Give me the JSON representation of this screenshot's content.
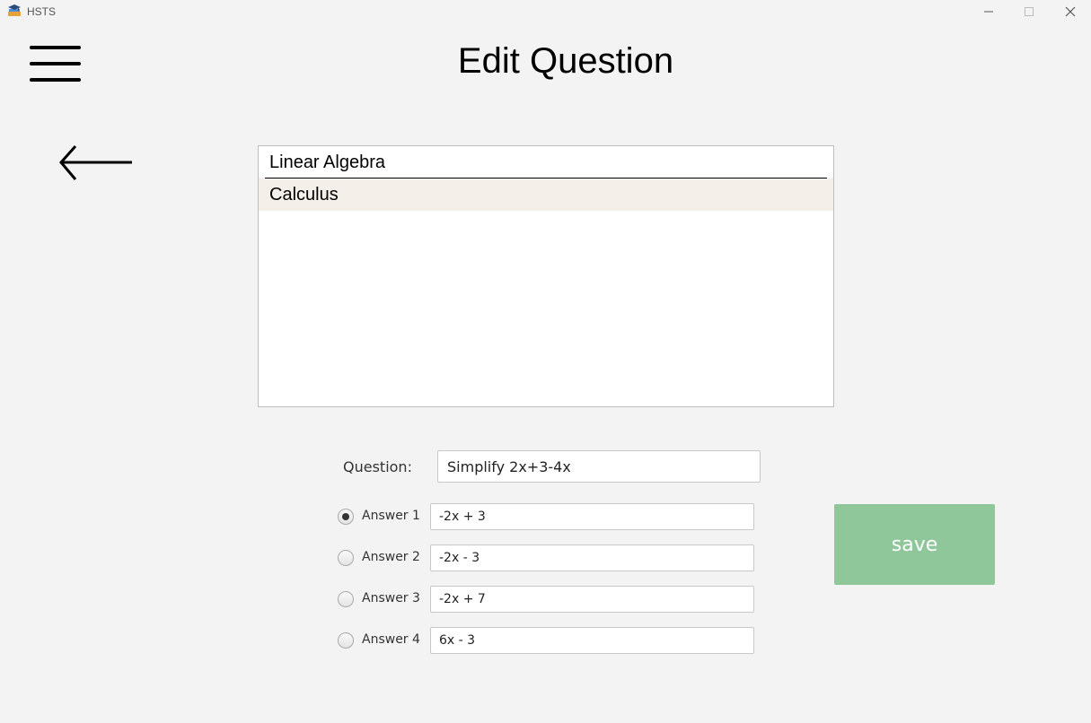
{
  "window": {
    "app_title": "HSTS",
    "icon": "app-icon",
    "controls": [
      "minimize-icon",
      "maximize-icon",
      "close-icon"
    ]
  },
  "header": {
    "title": "Edit Question",
    "menu_icon": "hamburger-menu-icon"
  },
  "nav": {
    "back_icon": "back-arrow-icon"
  },
  "subjects": {
    "items": [
      {
        "label": "Linear Algebra",
        "selected": false
      },
      {
        "label": "Calculus",
        "selected": true
      }
    ]
  },
  "form": {
    "question_label": "Question:",
    "question_value": "Simplify 2x+3-4x",
    "answers": [
      {
        "label": "Answer 1",
        "value": "-2x + 3",
        "checked": true
      },
      {
        "label": "Answer 2",
        "value": "-2x - 3",
        "checked": false
      },
      {
        "label": "Answer 3",
        "value": "-2x + 7",
        "checked": false
      },
      {
        "label": "Answer 4",
        "value": "6x - 3",
        "checked": false
      }
    ],
    "save_label": "save"
  },
  "colors": {
    "background": "#f3f3f3",
    "save_button": "#8fc79b",
    "selected_item": "#f5efe9"
  }
}
